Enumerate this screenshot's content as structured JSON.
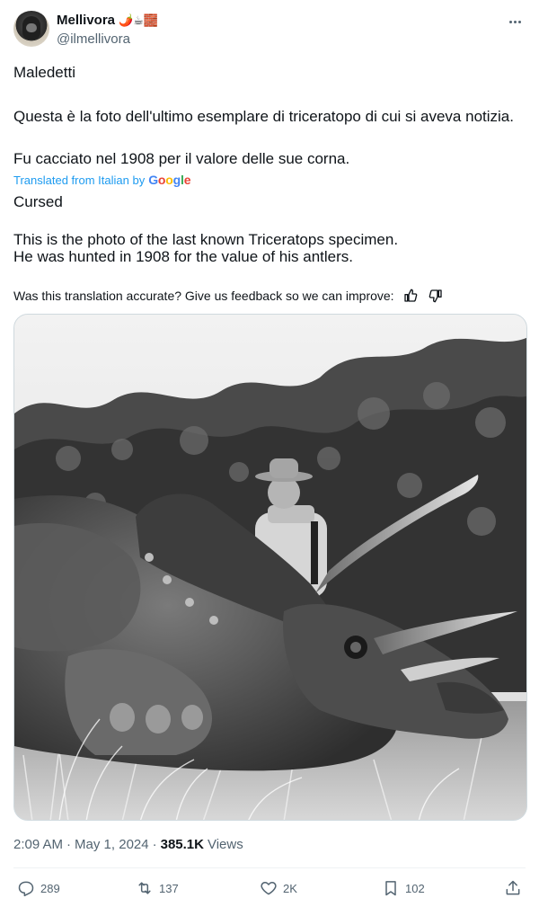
{
  "author": {
    "display_name": "Mellivora",
    "emojis": "🌶️☕🧱",
    "handle": "@ilmellivora"
  },
  "tweet": {
    "original_lines": [
      "Maledetti",
      "Questa è la foto dell'ultimo esemplare di triceratopo di cui si aveva notizia.",
      "Fu cacciato nel 1908 per il valore delle sue corna."
    ],
    "translated_from": "Translated from Italian by",
    "translated_lines": [
      "Cursed",
      "This is the photo of the last known Triceratops specimen.",
      "He was hunted in 1908 for the value of his antlers."
    ],
    "feedback_prompt": "Was this translation accurate? Give us feedback so we can improve:"
  },
  "meta": {
    "time": "2:09 AM",
    "date": "May 1, 2024",
    "separator": "·",
    "views_count": "385.1K",
    "views_label": "Views"
  },
  "actions": {
    "replies": "289",
    "reposts": "137",
    "likes": "2K",
    "bookmarks": "102"
  },
  "icons": {
    "more": "more-icon",
    "thumbs_up": "thumbs-up-icon",
    "thumbs_down": "thumbs-down-icon",
    "reply": "reply-icon",
    "repost": "repost-icon",
    "like": "heart-icon",
    "bookmark": "bookmark-icon",
    "share": "share-icon"
  },
  "colors": {
    "link": "#1d9bf0",
    "secondary_text": "#536471",
    "primary_text": "#0f1419"
  }
}
